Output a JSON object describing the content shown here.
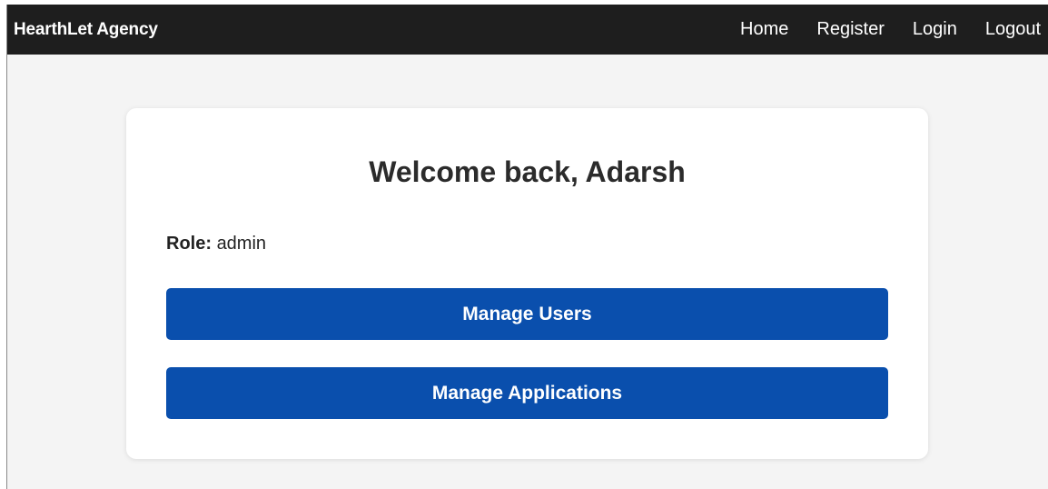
{
  "navbar": {
    "brand": "HearthLet Agency",
    "links": [
      "Home",
      "Register",
      "Login",
      "Logout"
    ]
  },
  "card": {
    "title": "Welcome back, Adarsh",
    "role_label": "Role:",
    "role_value": "admin",
    "buttons": [
      "Manage Users",
      "Manage Applications"
    ]
  },
  "colors": {
    "navbar_bg": "#1e1e1e",
    "page_bg": "#f4f4f4",
    "card_bg": "#ffffff",
    "button_bg": "#0a4fad",
    "button_text": "#ffffff"
  }
}
